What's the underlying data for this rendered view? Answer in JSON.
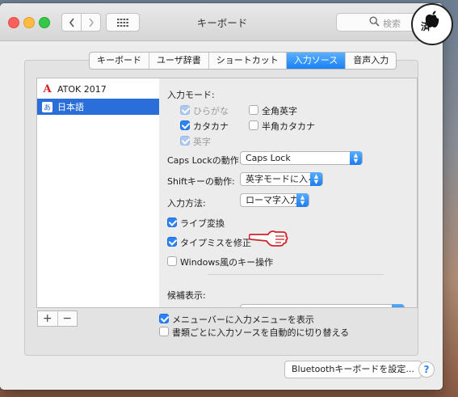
{
  "window": {
    "title": "キーボード"
  },
  "search": {
    "placeholder": "検索"
  },
  "tabs": [
    {
      "label": "キーボード"
    },
    {
      "label": "ユーザ辞書"
    },
    {
      "label": "ショートカット"
    },
    {
      "label": "入力ソース"
    },
    {
      "label": "音声入力"
    }
  ],
  "selected_tab": "入力ソース",
  "sources": [
    {
      "label": "ATOK 2017",
      "icon": "atok-icon",
      "selected": false
    },
    {
      "label": "日本語",
      "icon": "japanese-input-icon",
      "selected": true,
      "icon_glyph": "あ"
    }
  ],
  "details": {
    "input_modes_heading": "入力モード:",
    "modes": [
      {
        "label": "ひらがな",
        "checked": true,
        "disabled": true
      },
      {
        "label": "全角英字",
        "checked": false,
        "disabled": false
      },
      {
        "label": "カタカナ",
        "checked": true,
        "disabled": false
      },
      {
        "label": "半角カタカナ",
        "checked": false,
        "disabled": false
      },
      {
        "label": "英字",
        "checked": true,
        "disabled": true
      }
    ],
    "caps_lock": {
      "label": "Caps Lockの動作:",
      "value": "Caps Lock"
    },
    "shift": {
      "label": "Shiftキーの動作:",
      "value": "英字モードに入る"
    },
    "input_method": {
      "label": "入力方法:",
      "value": "ローマ字入力"
    },
    "options": [
      {
        "label": "ライブ変換",
        "checked": true
      },
      {
        "label": "タイプミスを修正",
        "checked": true
      },
      {
        "label": "Windows風のキー操作",
        "checked": false
      }
    ],
    "candidates_heading": "候補表示:"
  },
  "bottom": {
    "plus": "+",
    "minus": "−",
    "show_menu": {
      "label": "メニューバーに入力メニューを表示",
      "checked": true
    },
    "auto_switch": {
      "label": "書類ごとに入力ソースを自動的に切り替える",
      "checked": false
    }
  },
  "bluetooth_button": "Bluetoothキーボードを設定...",
  "help": "?",
  "logo": {
    "text": "済",
    "icon": "apple-logo-icon"
  },
  "annotation": {
    "icon": "pointing-hand-icon"
  },
  "colors": {
    "accent": "#2a6fd9",
    "tab_active": "#1a80f5",
    "checkbox": "#2c83f6"
  }
}
